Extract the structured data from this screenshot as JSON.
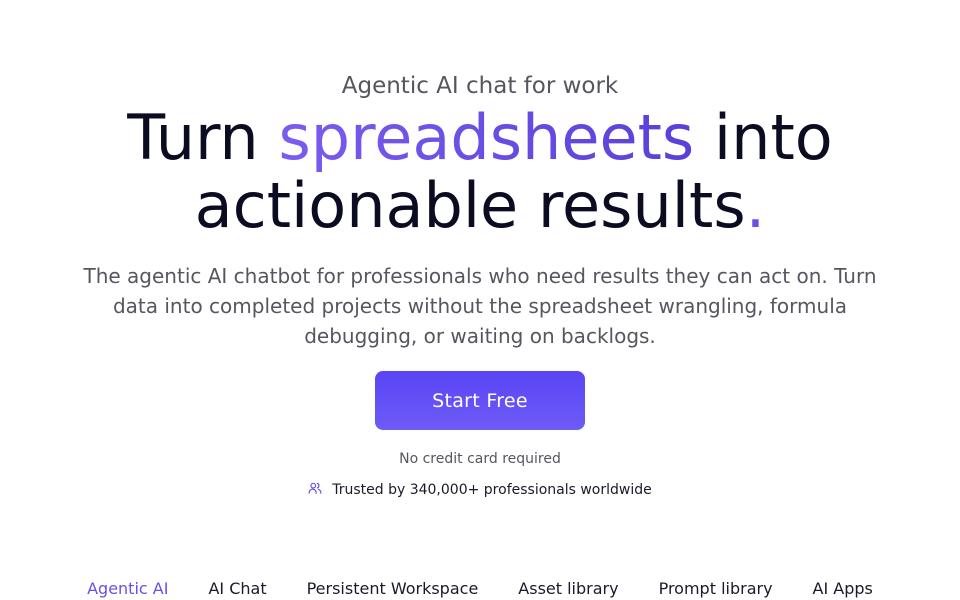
{
  "hero": {
    "eyebrow": "Agentic AI chat for work",
    "headline": {
      "part1": "Turn ",
      "highlight": "spreadsheets",
      "part2": " into",
      "line2": "actionable results",
      "dot": "."
    },
    "subcopy": "The agentic AI chatbot for professionals who need results they can act on. Turn data into completed projects without the spreadsheet wrangling, formula debugging, or waiting on backlogs.",
    "cta_label": "Start Free",
    "no_card_note": "No credit card required",
    "trust_text": "Trusted by 340,000+ professionals worldwide",
    "trust_icon": "users-icon"
  },
  "nav": {
    "items": [
      {
        "label": "Agentic AI",
        "active": true
      },
      {
        "label": "AI Chat",
        "active": false
      },
      {
        "label": "Persistent Workspace",
        "active": false
      },
      {
        "label": "Asset library",
        "active": false
      },
      {
        "label": "Prompt library",
        "active": false
      },
      {
        "label": "AI Apps",
        "active": false
      }
    ]
  },
  "colors": {
    "accent": "#6b4fe6",
    "cta_gradient_start": "#5a44f5",
    "cta_gradient_end": "#6c5cf7",
    "text_dark": "#0b0b22",
    "text_muted": "#56565f"
  }
}
